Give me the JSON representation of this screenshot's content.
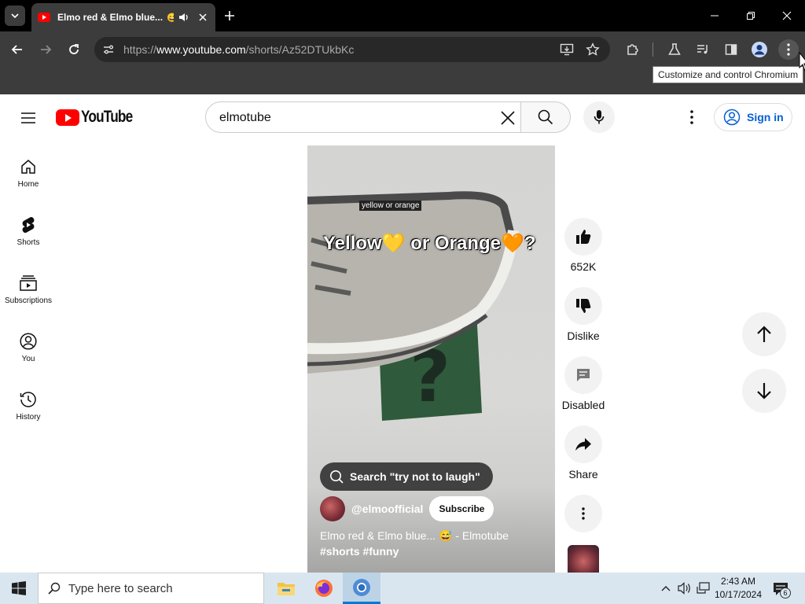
{
  "browser": {
    "tab": {
      "title": "Elmo red & Elmo blue...",
      "emoji": "😅"
    },
    "url": {
      "scheme": "https://",
      "host": "www.youtube.com",
      "path": "/shorts/Az52DTUkbKc"
    },
    "tooltip": "Customize and control Chromium"
  },
  "youtube": {
    "logo_text": "YouTube",
    "search_value": "elmotube",
    "sign_in": "Sign in",
    "nav": [
      {
        "label": "Home"
      },
      {
        "label": "Shorts"
      },
      {
        "label": "Subscriptions"
      },
      {
        "label": "You"
      },
      {
        "label": "History"
      }
    ],
    "short": {
      "caption_small": "yellow or orange",
      "caption_big": {
        "part1": "Yellow",
        "heart1": "💛",
        "part2": " or Orange",
        "heart2": "🧡",
        "part3": "?"
      },
      "search_pill": "Search \"try not to laugh\"",
      "channel": "@elmoofficial",
      "subscribe": "Subscribe",
      "title": "Elmo red & Elmo blue... 😅 - Elmotube",
      "tags": "#shorts #funny"
    },
    "actions": {
      "likes": "652K",
      "dislike": "Dislike",
      "comments": "Disabled",
      "share": "Share"
    }
  },
  "taskbar": {
    "search_placeholder": "Type here to search",
    "time": "2:43 AM",
    "date": "10/17/2024",
    "notification_count": "6"
  },
  "colors": {
    "youtube_red": "#ff0000",
    "link_blue": "#065fd4",
    "chrome_dark": "#3c3c3c"
  }
}
